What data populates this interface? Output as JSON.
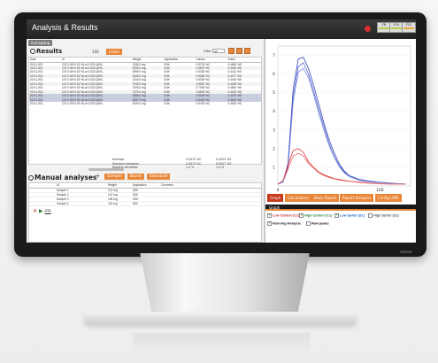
{
  "app": {
    "title": "Analysis & Results"
  },
  "window_buttons": [
    {
      "label": "F8",
      "color": "#b8c94a"
    },
    {
      "label": "F10",
      "color": "#b8c94a"
    },
    {
      "label": "F12",
      "color": "#e9a73a"
    }
  ],
  "toolbar": {
    "cut_label": "Cut saving"
  },
  "results": {
    "title": "Results",
    "segment_label": "100",
    "tab_label": "Limits",
    "filter_label": "Filter",
    "filter_value": "All",
    "columns": [
      "Date",
      "Id",
      "Weight",
      "Application",
      "Carbon",
      "Sulfur"
    ],
    "rows": [
      [
        "20.01.202..",
        "C/S 0.06+0.03 %Lot 0.023 (AR4..",
        "1155.0 mg",
        "IDIK",
        "0.5703 %C",
        "0.4650 %S"
      ],
      [
        "20.01.202..",
        "C/S 0.06+0.03 %Lot 0.023 (AR4..",
        "2535.0 mg",
        "IDIK",
        "0.5507 %C",
        "0.4434 %S"
      ],
      [
        "20.01.202..",
        "C/S 0.06+0.03 %Lot 0.023 (AR4..",
        "3995.0 mg",
        "IDIK",
        "0.5330 %C",
        "0.4411 %S"
      ],
      [
        "20.01.202..",
        "C/S 0.06+0.03 %Lot 0.023 (AR4..",
        "3155.0 mg",
        "IDIK",
        "0.5382 %C",
        "0.4377 %S"
      ],
      [
        "20.01.202..",
        "C/S 0.06+0.03 %Lot 0.023 (AR4..",
        "1315.0 mg",
        "IDIK",
        "0.5339 %C",
        "0.4434 %S"
      ],
      [
        "20.01.202..",
        "C/S 0.06+0.03 %Lot 0.023 (AR4..",
        "7045.0 mg",
        "IDIK",
        "0.5387 %C",
        "0.4435 %S"
      ],
      [
        "20.01.202..",
        "C/S 0.06+0.03 %Lot 0.023 (AR4..",
        "7525.0 mg",
        "IDIK",
        "0.7300 %C",
        "0.4800 %S"
      ],
      [
        "20.01.202..",
        "C/S 0.06+0.03 %Lot 0.023 (AR4..",
        "7375.0 mg",
        "IDIK",
        "0.5633 %C",
        "0.4222 %S"
      ],
      [
        "20.01.202..",
        "C/S 0.06+0.03 %Lot 0.023 (AR4..",
        "9356.0 mg",
        "IDIK",
        "0.5348 %C",
        "0.4479 %S"
      ],
      [
        "20.01.202..",
        "C/S 0.06+0.03 %Lot 0.023 (AR4..",
        "4357.0 mg",
        "IDIK",
        "0.5404 %C",
        "0.4402 %S"
      ],
      [
        "20.01.202..",
        "C/S 0.06+0.03 %Lot 0.023 (AR4..",
        "3333.0 mg",
        "IDIK",
        "0.5433 %C",
        "0.4343 %S"
      ]
    ],
    "highlight_rows": [
      8,
      9
    ],
    "stats": [
      {
        "label": "Average",
        "carbon": "0.5413 %C",
        "sulfur": "0.4325 %S"
      },
      {
        "label": "Standard deviation",
        "carbon": "0.0073 %C",
        "sulfur": "0.0047 %S"
      },
      {
        "label": "Relative deviation",
        "carbon": "1.4 %",
        "sulfur": "1.0 %"
      }
    ]
  },
  "manual": {
    "title": "Manual analyses",
    "plus": "+",
    "tabs": [
      "Sample",
      "Blank",
      "Standard"
    ],
    "columns": [
      "Id",
      "Weight",
      "Application",
      "Comment"
    ],
    "rows": [
      {
        "id": "Sample 1",
        "weight": "121",
        "unit": "mg",
        "app": "IDIK"
      },
      {
        "id": "Sample 2",
        "weight": "141",
        "unit": "mg",
        "app": "IDIK"
      },
      {
        "id": "Sample 3",
        "weight": "136",
        "unit": "mg",
        "app": "IDIK"
      },
      {
        "id": "Sample 4",
        "weight": "144",
        "unit": "mg",
        "app": "IDIK"
      }
    ],
    "row_action": "ATA"
  },
  "graph": {
    "tabs": [
      "Graph",
      "Calculations",
      "Basic Report",
      "Report Designer",
      "Config LIMS"
    ],
    "panel_title": "Graph",
    "legend": [
      {
        "label": "Low Carbon (C1)",
        "checked": true,
        "color": "#c62828"
      },
      {
        "label": "High Carbon (C1)",
        "checked": true,
        "color": "#2e7d32"
      },
      {
        "label": "Low Sulfur (S1)",
        "checked": true,
        "color": "#1565c0"
      },
      {
        "label": "High Sulfur (S1)",
        "checked": false,
        "color": "#555555"
      },
      {
        "label": "Running Analysis",
        "checked": true,
        "color": "#222222"
      },
      {
        "label": "Raw peaks",
        "checked": false,
        "color": "#222222"
      }
    ]
  },
  "chart_data": {
    "type": "line",
    "x_ticks": [
      "0",
      "100"
    ],
    "y_ticks": [
      "7",
      "6",
      "5",
      "4",
      "3",
      "2",
      "1"
    ],
    "ylim": [
      0,
      7.5
    ],
    "xlim": [
      0,
      130
    ],
    "series": [
      {
        "color": "#3344bb",
        "x": [
          0,
          5,
          10,
          15,
          20,
          25,
          30,
          35,
          40,
          45,
          50,
          55,
          60,
          65,
          70,
          80,
          90,
          100,
          110,
          125
        ],
        "values": [
          0.1,
          0.2,
          1.2,
          5.2,
          6.8,
          6.9,
          6.3,
          5.4,
          4.4,
          3.4,
          2.5,
          1.8,
          1.2,
          0.8,
          0.55,
          0.35,
          0.25,
          0.2,
          0.15,
          0.1
        ]
      },
      {
        "color": "#5566cc",
        "x": [
          0,
          5,
          10,
          15,
          20,
          25,
          30,
          35,
          40,
          45,
          50,
          55,
          60,
          65,
          70,
          80,
          90,
          100,
          110,
          125
        ],
        "values": [
          0.1,
          0.2,
          1.0,
          4.8,
          6.4,
          6.6,
          6.0,
          5.1,
          4.1,
          3.2,
          2.3,
          1.6,
          1.1,
          0.75,
          0.5,
          0.3,
          0.22,
          0.18,
          0.14,
          0.1
        ]
      },
      {
        "color": "#7788dd",
        "x": [
          0,
          5,
          10,
          15,
          20,
          25,
          30,
          35,
          40,
          45,
          50,
          55,
          60,
          65,
          70,
          80,
          90,
          100,
          110,
          125
        ],
        "values": [
          0.1,
          0.2,
          0.9,
          4.5,
          6.1,
          6.3,
          5.8,
          4.9,
          3.9,
          3.0,
          2.2,
          1.55,
          1.05,
          0.7,
          0.5,
          0.3,
          0.22,
          0.18,
          0.14,
          0.1
        ]
      },
      {
        "color": "#d32f2f",
        "x": [
          0,
          5,
          10,
          15,
          20,
          25,
          30,
          35,
          40,
          45,
          50,
          55,
          60,
          65,
          70,
          80,
          90,
          100,
          110,
          125
        ],
        "values": [
          0.1,
          0.3,
          1.1,
          1.9,
          2.0,
          1.8,
          1.3,
          1.0,
          0.75,
          0.6,
          0.5,
          0.4,
          0.35,
          0.3,
          0.25,
          0.2,
          0.15,
          0.12,
          0.1,
          0.1
        ]
      },
      {
        "color": "#ef6c6c",
        "x": [
          0,
          5,
          10,
          15,
          20,
          25,
          30,
          35,
          40,
          45,
          50,
          55,
          60,
          65,
          70,
          80,
          90,
          100,
          110,
          125
        ],
        "values": [
          0.1,
          0.3,
          0.9,
          1.6,
          1.75,
          1.6,
          1.2,
          0.95,
          0.7,
          0.55,
          0.45,
          0.38,
          0.32,
          0.28,
          0.24,
          0.18,
          0.14,
          0.11,
          0.1,
          0.1
        ]
      }
    ]
  }
}
